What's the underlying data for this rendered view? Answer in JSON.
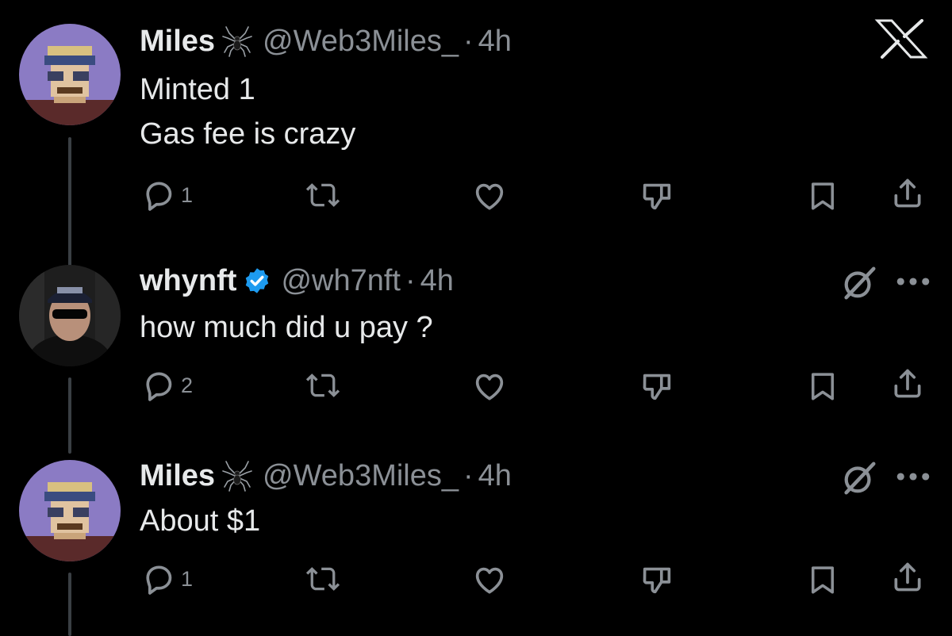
{
  "tweets": [
    {
      "name": "Miles",
      "handle": "@Web3Miles_",
      "separator": "·",
      "time": "4h",
      "lines": [
        "Minted 1",
        "Gas fee is crazy"
      ],
      "reply_count": "1"
    },
    {
      "name": "whynft",
      "handle": "@wh7nft",
      "separator": "·",
      "time": "4h",
      "lines": [
        "how much did u pay ?"
      ],
      "reply_count": "2"
    },
    {
      "name": "Miles",
      "handle": "@Web3Miles_",
      "separator": "·",
      "time": "4h",
      "lines": [
        "About $1"
      ],
      "reply_count": "1"
    }
  ],
  "icons": {
    "close": "x-logo-icon",
    "reply": "reply-icon",
    "repost": "repost-icon",
    "like": "heart-icon",
    "dislike": "thumbs-down-icon",
    "bookmark": "bookmark-icon",
    "share": "share-icon",
    "more": "more-icon",
    "grok": "grok-icon",
    "verified": "verified-badge-icon",
    "spider": "spider-icon"
  },
  "colors": {
    "background": "#000000",
    "text": "#e7e9ea",
    "muted": "#8b9096",
    "verified": "#1d9bf0"
  }
}
